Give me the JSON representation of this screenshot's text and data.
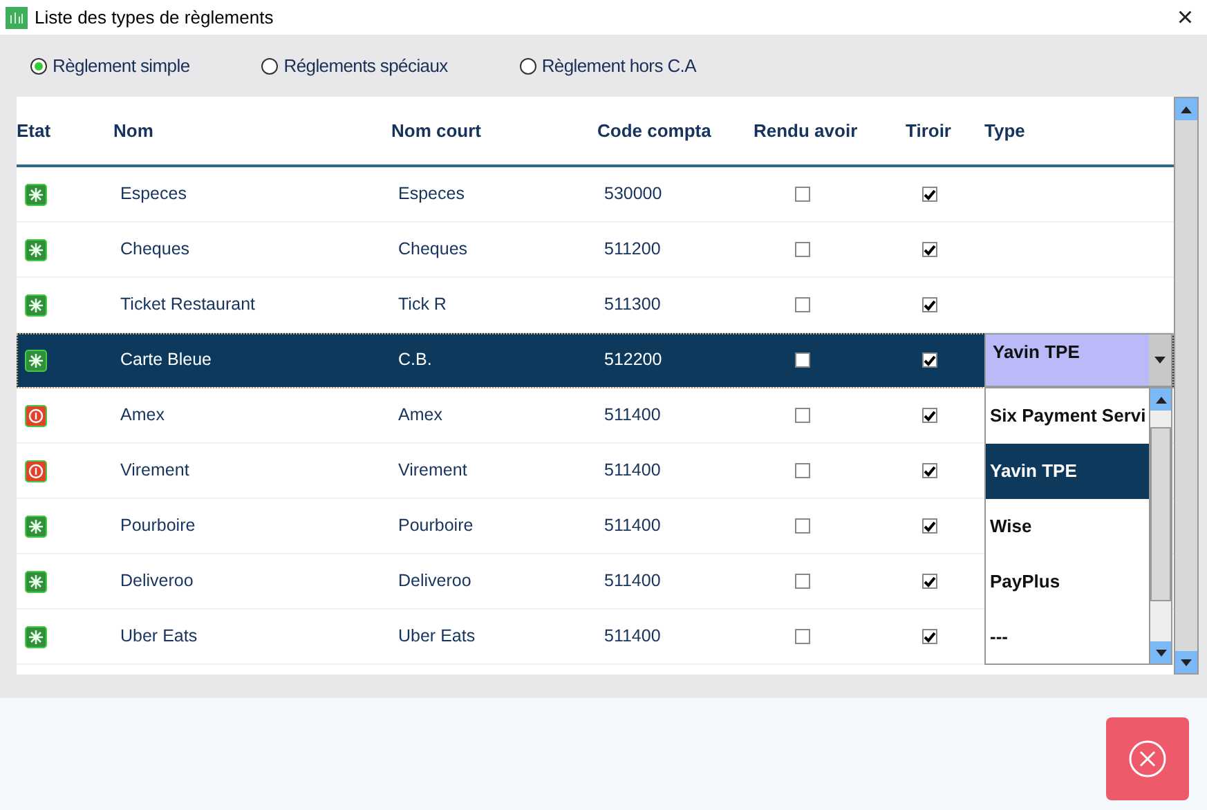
{
  "window": {
    "title": "Liste des types de règlements",
    "close": "×"
  },
  "modes": [
    {
      "label": "Règlement simple",
      "selected": true
    },
    {
      "label": "Réglements spéciaux",
      "selected": false
    },
    {
      "label": "Règlement hors C.A",
      "selected": false
    }
  ],
  "table": {
    "columns": [
      "Etat",
      "Nom",
      "Nom court",
      "Code compta",
      "Rendu avoir",
      "Tiroir",
      "Type"
    ],
    "rows": [
      {
        "kind": "active",
        "name": "Especes",
        "short": "Especes",
        "code": "530000",
        "rendu_avoir": false,
        "tiroir": true,
        "selected": false
      },
      {
        "kind": "active",
        "name": "Cheques",
        "short": "Cheques",
        "code": "511200",
        "rendu_avoir": false,
        "tiroir": true,
        "selected": false
      },
      {
        "kind": "active",
        "name": "Ticket Restaurant",
        "short": "Tick R",
        "code": "511300",
        "rendu_avoir": false,
        "tiroir": true,
        "selected": false
      },
      {
        "kind": "active",
        "name": "Carte Bleue",
        "short": "C.B.",
        "code": "512200",
        "rendu_avoir": false,
        "tiroir": true,
        "selected": true,
        "type": "Yavin TPE"
      },
      {
        "kind": "stopped",
        "name": "Amex",
        "short": "Amex",
        "code": "511400",
        "rendu_avoir": false,
        "tiroir": true,
        "selected": false
      },
      {
        "kind": "stopped",
        "name": "Virement",
        "short": "Virement",
        "code": "511400",
        "rendu_avoir": false,
        "tiroir": true,
        "selected": false
      },
      {
        "kind": "active",
        "name": "Pourboire",
        "short": "Pourboire",
        "code": "511400",
        "rendu_avoir": false,
        "tiroir": true,
        "selected": false
      },
      {
        "kind": "active",
        "name": "Deliveroo",
        "short": "Deliveroo",
        "code": "511400",
        "rendu_avoir": false,
        "tiroir": true,
        "selected": false
      },
      {
        "kind": "active",
        "name": "Uber Eats",
        "short": "Uber Eats",
        "code": "511400",
        "rendu_avoir": false,
        "tiroir": true,
        "selected": false
      }
    ]
  },
  "type_dropdown": {
    "options": [
      {
        "label": "Six Payment Servi",
        "selected": false
      },
      {
        "label": "Yavin TPE",
        "selected": true
      },
      {
        "label": "Wise",
        "selected": false
      },
      {
        "label": "PayPlus",
        "selected": false
      },
      {
        "label": "---",
        "selected": false
      }
    ]
  }
}
